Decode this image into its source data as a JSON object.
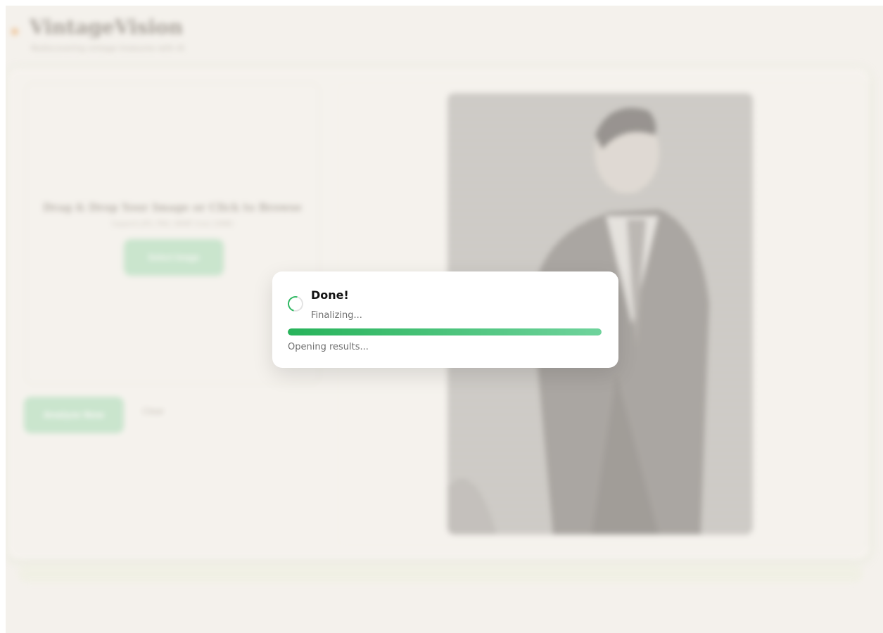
{
  "header": {
    "brand": "VintageVision",
    "tagline": "Rediscovering vintage treasures with AI"
  },
  "upload": {
    "title": "Drag & Drop Your Image or Click to Browse",
    "hint": "Supports JPG, PNG, WEBP (max 10MB)",
    "select_label": "Select Image"
  },
  "actions": {
    "analyze_label": "Analyze Now",
    "clear_label": "Clear"
  },
  "modal": {
    "title": "Done!",
    "subtitle": "Finalizing...",
    "progress": 100,
    "footer": "Opening results..."
  },
  "colors": {
    "accent": "#2fb862",
    "brand_dot": "#e9a25a"
  },
  "icons": {
    "brand": "logo-dot-icon",
    "loading": "spinner-icon"
  }
}
